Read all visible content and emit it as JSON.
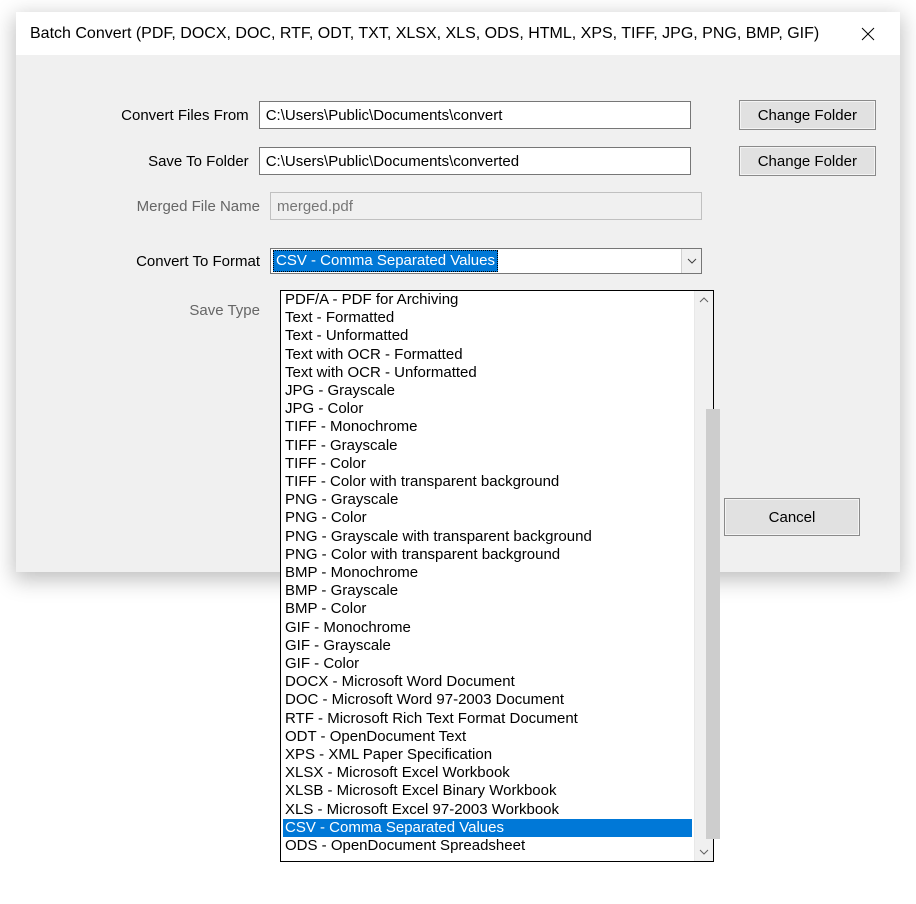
{
  "title": "Batch Convert (PDF, DOCX, DOC, RTF, ODT, TXT, XLSX, XLS, ODS, HTML, XPS, TIFF, JPG, PNG, BMP, GIF)",
  "labels": {
    "convert_from": "Convert Files From",
    "save_to": "Save To Folder",
    "merged_name": "Merged File Name",
    "convert_format": "Convert To Format",
    "save_type": "Save Type"
  },
  "fields": {
    "convert_from_value": "C:\\Users\\Public\\Documents\\convert",
    "save_to_value": "C:\\Users\\Public\\Documents\\converted",
    "merged_name_value": "merged.pdf"
  },
  "buttons": {
    "change_folder": "Change Folder",
    "cancel": "Cancel"
  },
  "combo": {
    "selected": "CSV - Comma Separated Values"
  },
  "dropdown": {
    "items": [
      "PDF/A - PDF for Archiving",
      "Text - Formatted",
      "Text - Unformatted",
      "Text with OCR - Formatted",
      "Text with OCR - Unformatted",
      "JPG - Grayscale",
      "JPG - Color",
      "TIFF - Monochrome",
      "TIFF - Grayscale",
      "TIFF - Color",
      "TIFF - Color with transparent background",
      "PNG - Grayscale",
      "PNG - Color",
      "PNG - Grayscale with transparent background",
      "PNG - Color with transparent background",
      "BMP - Monochrome",
      "BMP - Grayscale",
      "BMP - Color",
      "GIF - Monochrome",
      "GIF - Grayscale",
      "GIF - Color",
      "DOCX - Microsoft Word Document",
      "DOC - Microsoft Word 97-2003 Document",
      "RTF - Microsoft Rich Text Format Document",
      "ODT - OpenDocument Text",
      "XPS - XML Paper Specification",
      "XLSX - Microsoft Excel Workbook",
      "XLSB - Microsoft Excel Binary Workbook",
      "XLS - Microsoft Excel 97-2003 Workbook",
      "CSV - Comma Separated Values",
      "ODS - OpenDocument Spreadsheet"
    ],
    "selected_index": 29
  }
}
